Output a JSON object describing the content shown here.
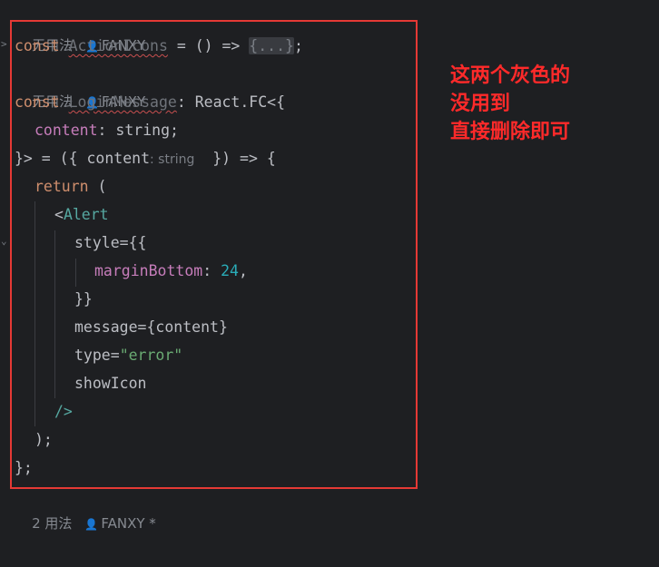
{
  "hints": {
    "top": {
      "usage": "无用法",
      "author": "FANXY"
    },
    "middle": {
      "usage": "无用法",
      "author": "FANXY"
    },
    "bottom": {
      "usage": "2 用法",
      "author": "FANXY",
      "suffix": "*"
    }
  },
  "code": {
    "l1": {
      "kw": "const",
      "name": "ActionIcons",
      "mid": " = () => ",
      "fold": "{...}",
      "end": ";"
    },
    "l2": {
      "kw": "const",
      "name": "LoginMessage",
      "rest": ": React.FC<{"
    },
    "l3": {
      "prop": "content",
      "rest": ": string;"
    },
    "l4": {
      "start": "}> = ({ content",
      "hint": ": string",
      "end": "  }) => {"
    },
    "l5": {
      "kw": "return",
      "rest": " ("
    },
    "l6": {
      "lt": "<",
      "tag": "Alert"
    },
    "l7": {
      "attr": "style",
      "rest": "={{"
    },
    "l8": {
      "prop": "marginBottom",
      "colon": ": ",
      "num": "24",
      "comma": ","
    },
    "l9": {
      "text": "}}"
    },
    "l10": {
      "attr": "message",
      "rest": "={content}"
    },
    "l11": {
      "attr": "type",
      "eq": "=",
      "str": "\"error\""
    },
    "l12": {
      "attr": "showIcon"
    },
    "l13": {
      "text": "/>"
    },
    "l14": {
      "text": ");"
    },
    "l15": {
      "text": "};"
    }
  },
  "annotation": {
    "line1": "这两个灰色的",
    "line2": "没用到",
    "line3": "直接删除即可",
    "color": "#ff2a2a"
  },
  "icons": {
    "user": "user-icon",
    "fold": "chevron-right-icon"
  }
}
